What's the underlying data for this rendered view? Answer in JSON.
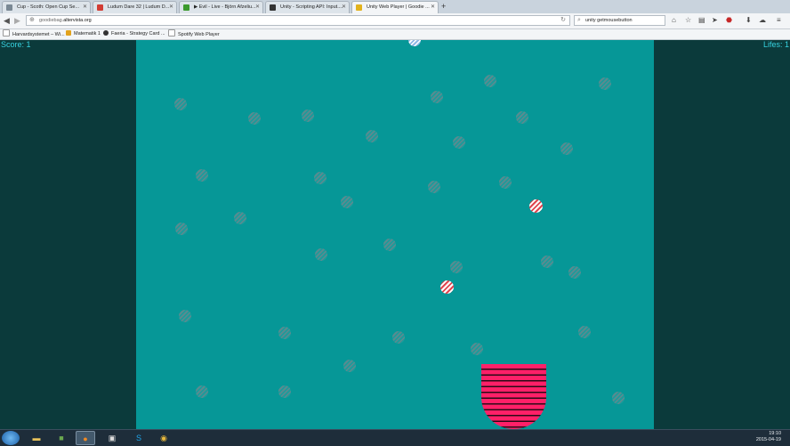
{
  "browser": {
    "tabs": [
      {
        "title": "Cup - Scoth: Open Cup Se...",
        "active": false
      },
      {
        "title": "Ludum Dare 32 | Ludum D...",
        "active": false
      },
      {
        "title": "▶ Evil - Live - Björn Afzeliu...",
        "active": false
      },
      {
        "title": "Unity - Scripting API: Input....",
        "active": false
      },
      {
        "title": "Unity Web Player | Goodie ...",
        "active": true
      }
    ],
    "new_tab": "+",
    "url_prefix": "goodiebag.",
    "url_domain": "altervista.org",
    "search_value": "unity getmousebutton",
    "bookmarks": [
      "Harvardsystemet – Wi...",
      "Matematik 1",
      "Faeria - Strategy Card ...",
      "Spotify Web Player"
    ]
  },
  "game": {
    "score_label": "Score: 1",
    "lifes_label": "Lifes: 1",
    "colors": {
      "field": "#069797",
      "side": "#0b3a3b",
      "hud": "#37d2e0",
      "cup": "#ff2068"
    }
  },
  "taskbar": {
    "time": "19:10",
    "date": "2015-04-19"
  }
}
